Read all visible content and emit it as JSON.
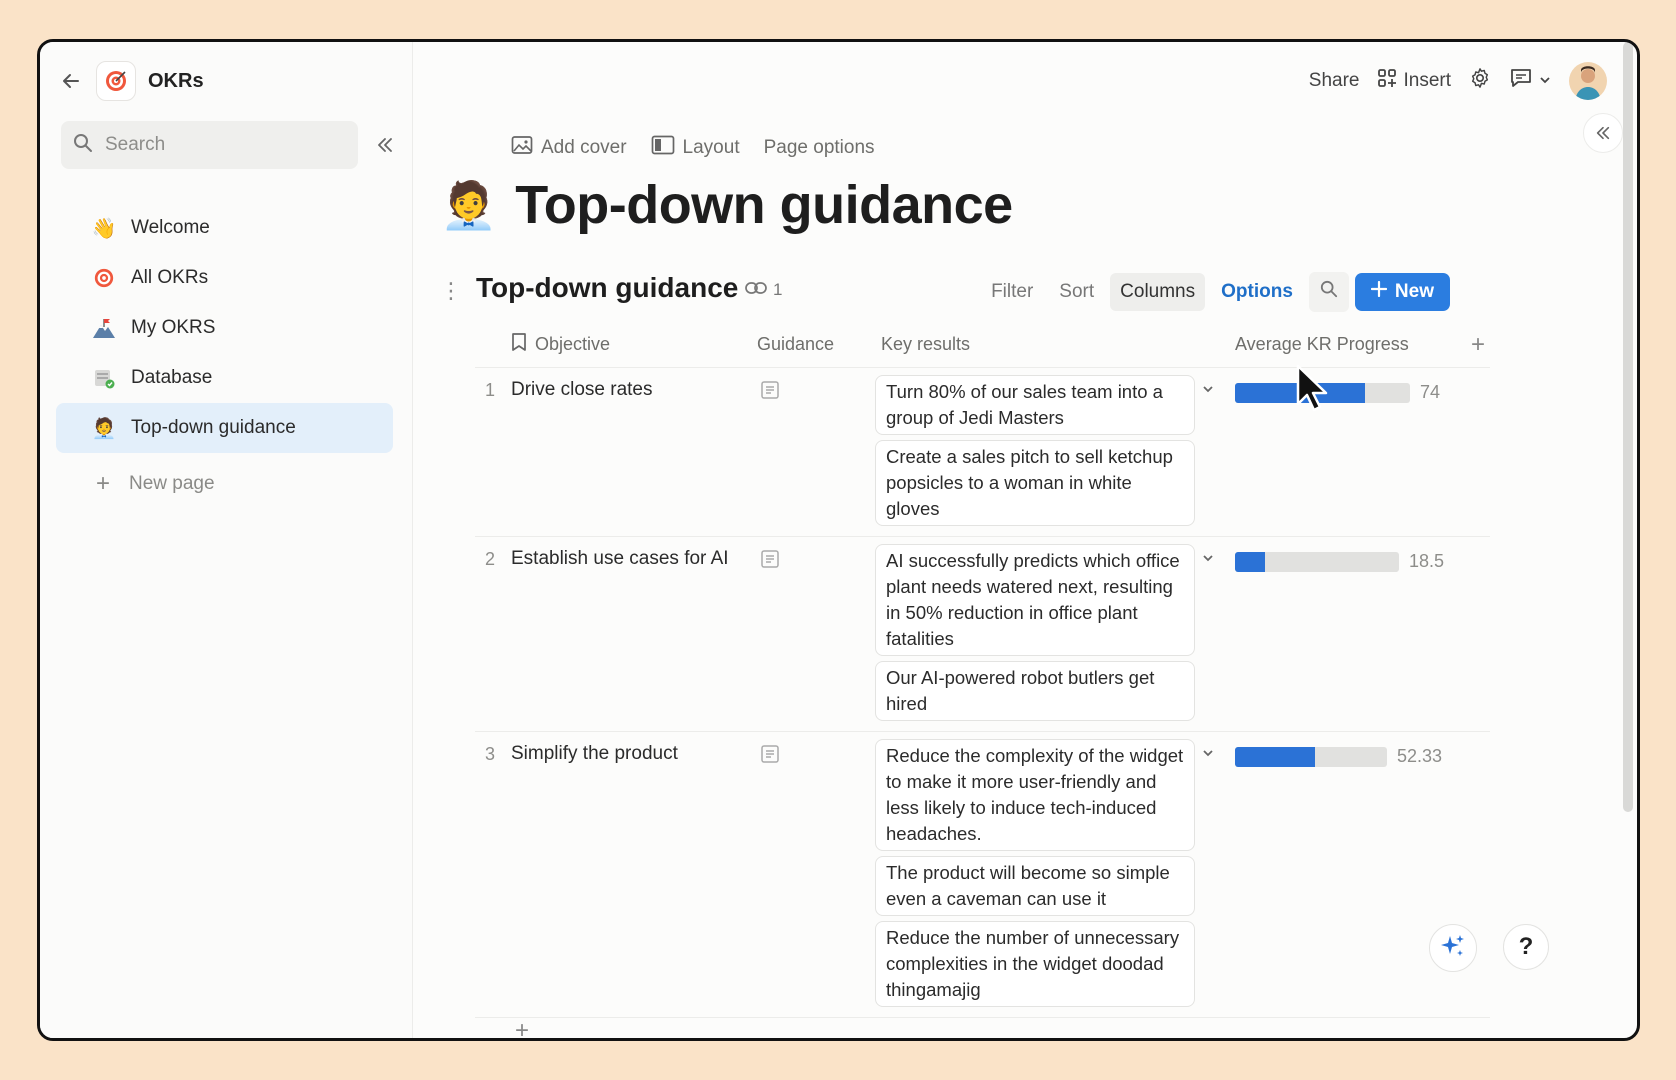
{
  "sidebar": {
    "app_name": "OKRs",
    "search_placeholder": "Search",
    "items": [
      {
        "label": "Welcome",
        "icon": "waving-hand-icon"
      },
      {
        "label": "All OKRs",
        "icon": "target-icon"
      },
      {
        "label": "My OKRS",
        "icon": "mountain-flag-icon"
      },
      {
        "label": "Database",
        "icon": "database-icon"
      },
      {
        "label": "Top-down guidance",
        "icon": "person-info-icon",
        "active": true
      }
    ],
    "new_page_label": "New page"
  },
  "topbar": {
    "share_label": "Share",
    "insert_label": "Insert"
  },
  "page": {
    "options": [
      "Add cover",
      "Layout",
      "Page options"
    ],
    "title": "Top-down guidance"
  },
  "database": {
    "title": "Top-down guidance",
    "link_count": "1",
    "actions": {
      "filter": "Filter",
      "sort": "Sort",
      "columns": "Columns",
      "options": "Options",
      "new": "New"
    },
    "columns": [
      "Objective",
      "Guidance",
      "Key results",
      "Average KR Progress"
    ],
    "rows": [
      {
        "num": "1",
        "objective": "Drive close rates",
        "key_results": [
          "Turn 80% of our sales team into a group of Jedi Masters",
          "Create a sales pitch to sell ketchup popsicles to a woman in white gloves"
        ],
        "progress": 74,
        "progress_label": "74"
      },
      {
        "num": "2",
        "objective": "Establish use cases for AI",
        "key_results": [
          "AI successfully predicts which office plant needs watered next, resulting in 50% reduction in office plant fatalities",
          "Our AI-powered robot butlers get hired"
        ],
        "progress": 18.5,
        "progress_label": "18.5"
      },
      {
        "num": "3",
        "objective": "Simplify the product",
        "key_results": [
          "Reduce the complexity of the widget to make it more user-friendly and less likely to induce tech-induced headaches.",
          "The product will become so simple even a caveman can use it",
          "Reduce the number of unnecessary complexities in the widget doodad thingamajig"
        ],
        "progress": 52.33,
        "progress_label": "52.33"
      }
    ]
  },
  "colors": {
    "accent": "#2b7de0",
    "progress_fill": "#2b72d6",
    "active_nav": "#e3effa",
    "background": "#fae3c8"
  }
}
